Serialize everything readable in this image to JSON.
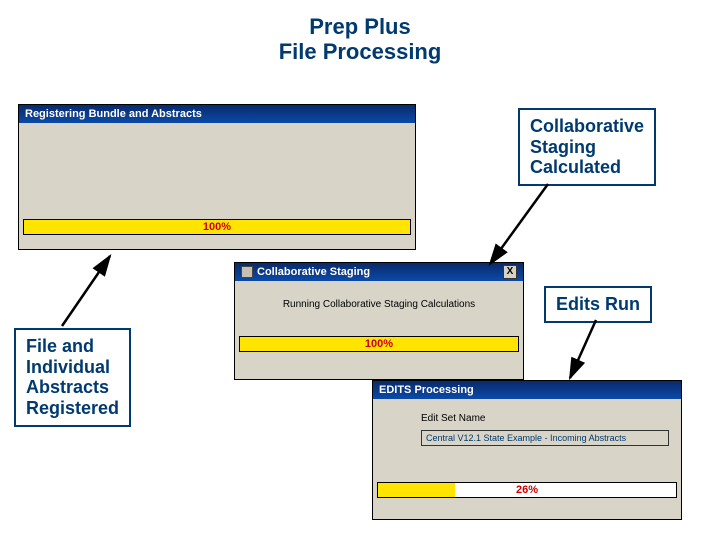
{
  "title_line1": "Prep Plus",
  "title_line2": "File Processing",
  "dialogs": {
    "d1": {
      "title": "Registering Bundle and Abstracts",
      "progress_pct": 100,
      "progress_label": "100%"
    },
    "d2": {
      "title": "Collaborative Staging",
      "close_label": "X",
      "message": "Running Collaborative Staging Calculations",
      "progress_pct": 100,
      "progress_label": "100%"
    },
    "d3": {
      "title": "EDITS Processing",
      "field_label": "Edit Set Name",
      "field_value": "Central V12.1 State Example - Incoming Abstracts",
      "progress_pct": 26,
      "progress_label": "26%"
    }
  },
  "callouts": {
    "c1_l1": "Collaborative",
    "c1_l2": "Staging",
    "c1_l3": "Calculated",
    "c2": "Edits Run",
    "c3_l1": "File and",
    "c3_l2": "Individual",
    "c3_l3": "Abstracts",
    "c3_l4": "Registered"
  }
}
